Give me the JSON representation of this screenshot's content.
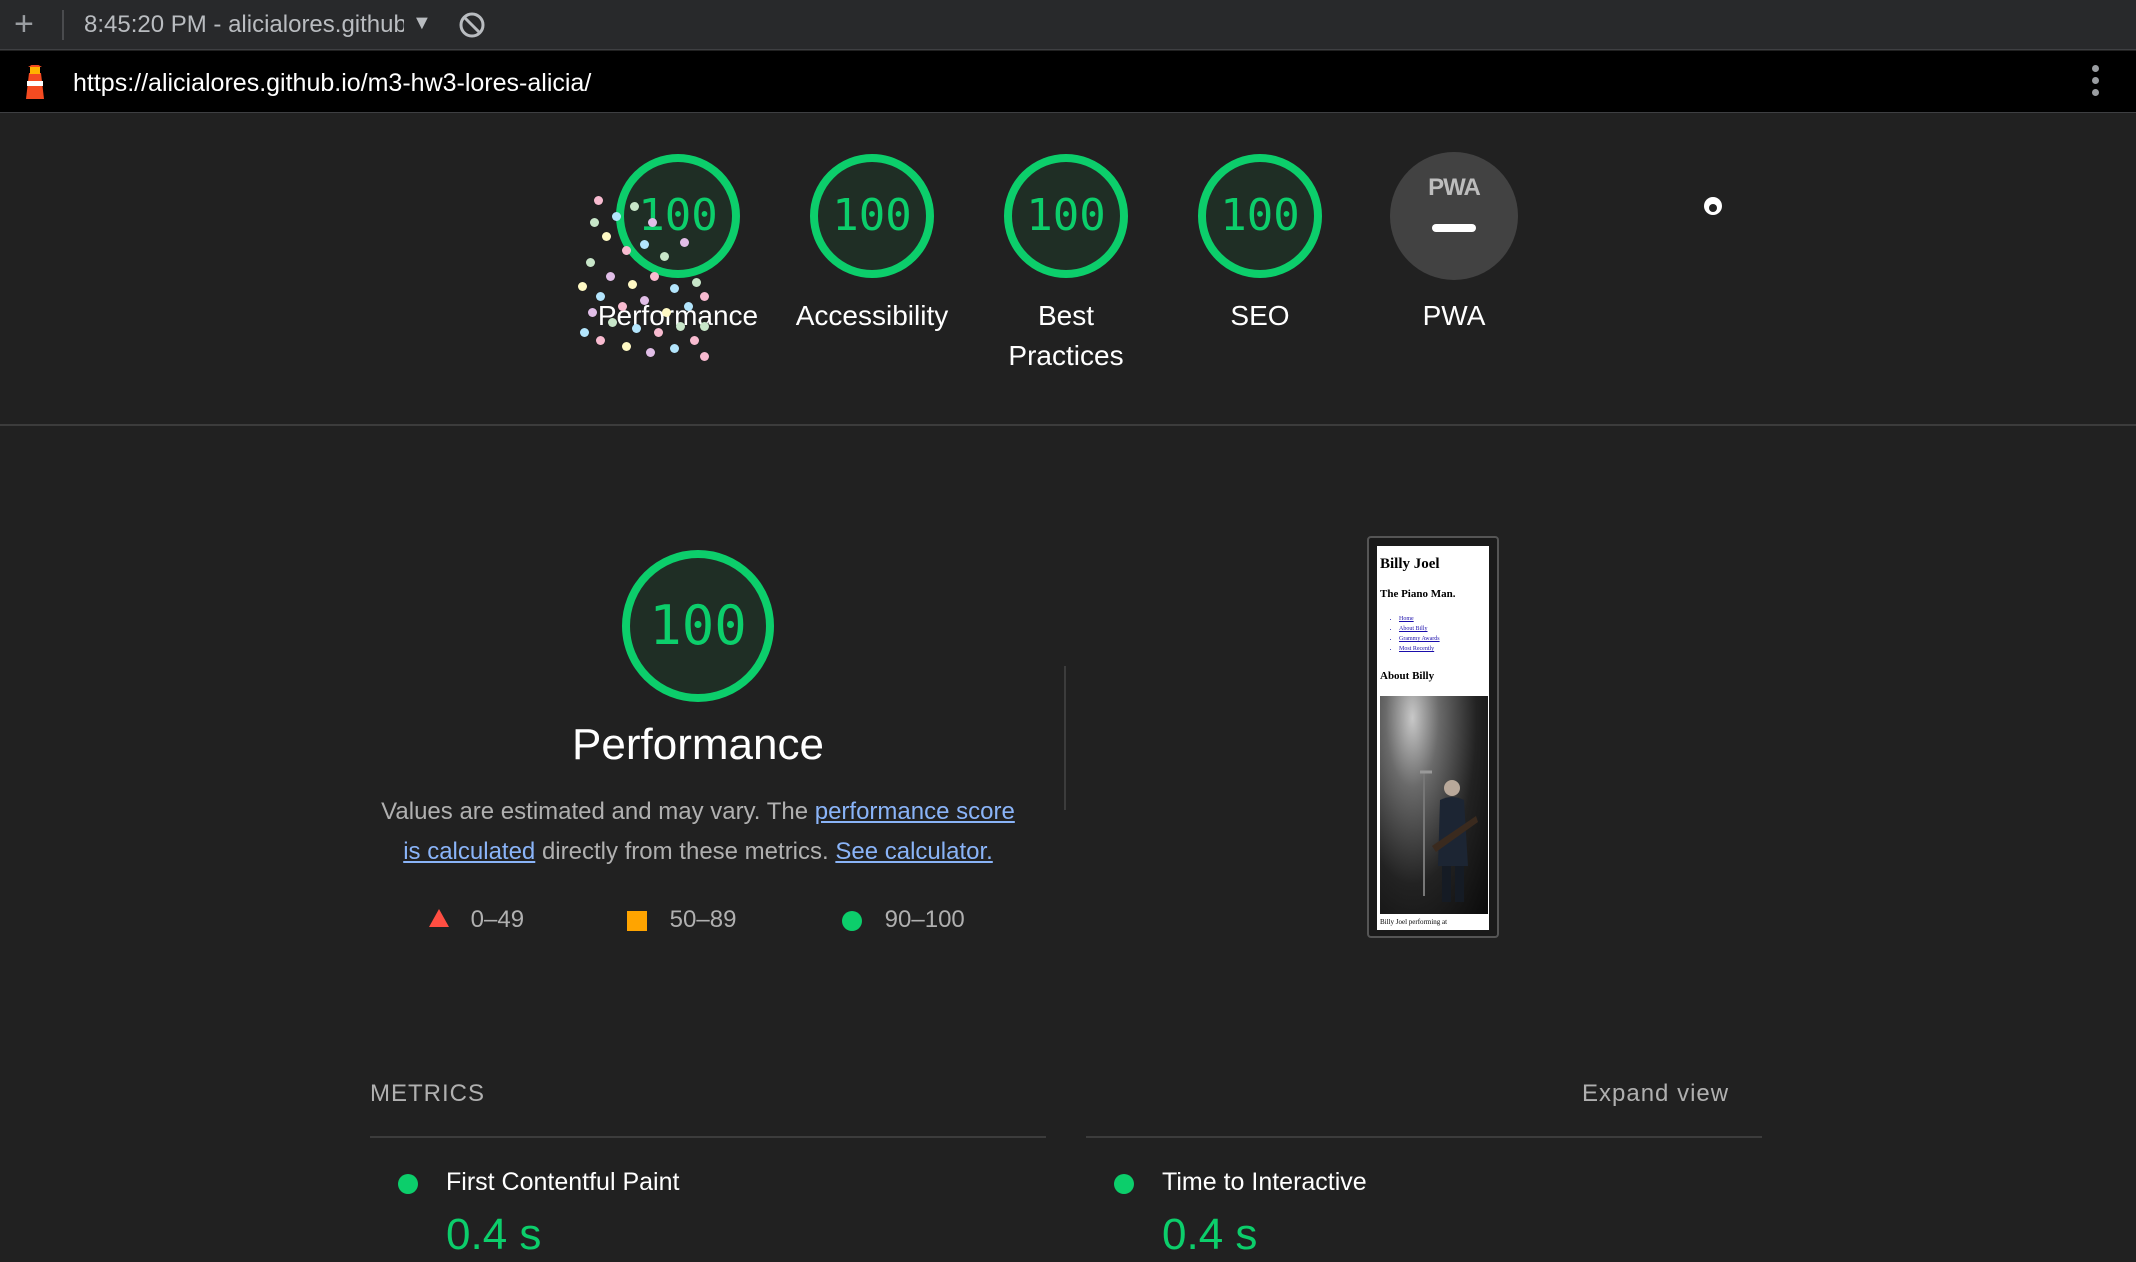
{
  "browser": {
    "new_tab": "+",
    "tab_title": "8:45:20 PM - alicialores.github",
    "url": "https://alicialores.github.io/m3-hw3-lores-alicia/"
  },
  "colors": {
    "pass": "#0cce6b",
    "average": "#ffa400",
    "fail": "#ff4e42",
    "link": "#8ab4f8"
  },
  "gauges": [
    {
      "score": "100",
      "label": "Performance"
    },
    {
      "score": "100",
      "label": "Accessibility"
    },
    {
      "score": "100",
      "label": "Best Practices"
    },
    {
      "score": "100",
      "label": "SEO"
    },
    {
      "badge": "PWA",
      "label": "PWA"
    }
  ],
  "performance": {
    "score": "100",
    "title": "Performance",
    "desc_text1": "Values are estimated and may vary. The ",
    "desc_link1": "performance score is calculated",
    "desc_text2": " directly from these metrics. ",
    "desc_link2": "See calculator."
  },
  "legend": [
    {
      "icon": "triangle-icon",
      "range": "0–49"
    },
    {
      "icon": "square-icon",
      "range": "50–89"
    },
    {
      "icon": "circle-icon",
      "range": "90–100"
    }
  ],
  "screenshot": {
    "heading": "Billy Joel",
    "subheading": "The Piano Man.",
    "nav": [
      "Home",
      "About Billy",
      "Grammy Awards",
      "Most Recently"
    ],
    "section": "About Billy",
    "caption": "Billy Joel performing at"
  },
  "metrics": {
    "header": "METRICS",
    "expand": "Expand view",
    "items": [
      {
        "name": "First Contentful Paint",
        "value": "0.4 s"
      },
      {
        "name": "Time to Interactive",
        "value": "0.4 s"
      }
    ]
  }
}
